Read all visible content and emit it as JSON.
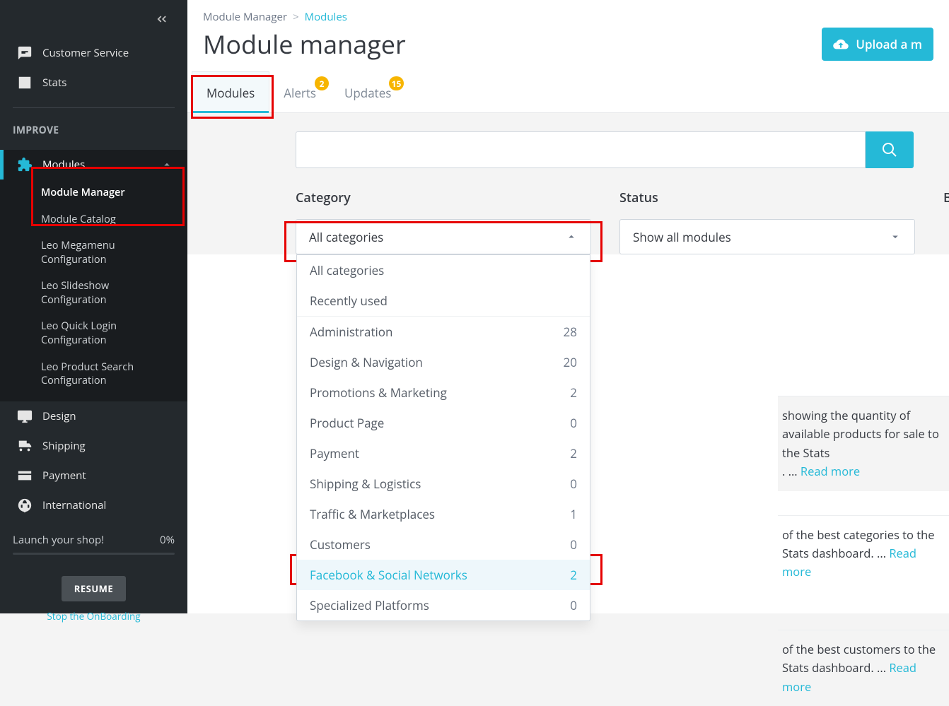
{
  "sidebar": {
    "customer_service": "Customer Service",
    "stats": "Stats",
    "section_title": "IMPROVE",
    "modules_label": "Modules",
    "sub": {
      "module_manager": "Module Manager",
      "module_catalog": "Module Catalog",
      "leo_megamenu": "Leo Megamenu Configuration",
      "leo_slideshow": "Leo Slideshow Configuration",
      "leo_quicklogin": "Leo Quick Login Configuration",
      "leo_productsearch": "Leo Product Search Configuration"
    },
    "design": "Design",
    "shipping": "Shipping",
    "payment": "Payment",
    "international": "International",
    "launch_label": "Launch your shop!",
    "launch_pct": "0%",
    "resume": "RESUME",
    "stop_link": "Stop the OnBoarding"
  },
  "breadcrumb": {
    "parent": "Module Manager",
    "current": "Modules"
  },
  "page_title": "Module manager",
  "upload_label": "Upload a m",
  "tabs": {
    "modules": "Modules",
    "alerts": "Alerts",
    "alerts_badge": "2",
    "updates": "Updates",
    "updates_badge": "15"
  },
  "filters": {
    "category_label": "Category",
    "category_value": "All categories",
    "status_label": "Status",
    "status_value": "Show all modules",
    "trailing_label": "B"
  },
  "category_options": [
    {
      "label": "All categories",
      "count": ""
    },
    {
      "label": "Recently used",
      "count": "",
      "sep_after": true
    },
    {
      "label": "Administration",
      "count": "28"
    },
    {
      "label": "Design & Navigation",
      "count": "20"
    },
    {
      "label": "Promotions & Marketing",
      "count": "2"
    },
    {
      "label": "Product Page",
      "count": "0"
    },
    {
      "label": "Payment",
      "count": "2"
    },
    {
      "label": "Shipping & Logistics",
      "count": "0"
    },
    {
      "label": "Traffic & Marketplaces",
      "count": "1"
    },
    {
      "label": "Customers",
      "count": "0"
    },
    {
      "label": "Facebook & Social Networks",
      "count": "2",
      "highlight": true
    },
    {
      "label": "Specialized Platforms",
      "count": "0"
    }
  ],
  "snippets": {
    "r1a": "showing the quantity of available products for sale to the Stats",
    "r1b": ". ... ",
    "r2": "of the best categories to the Stats dashboard. ... ",
    "r3": "of the best customers to the Stats dashboard. ... ",
    "read_more": "Read more"
  }
}
